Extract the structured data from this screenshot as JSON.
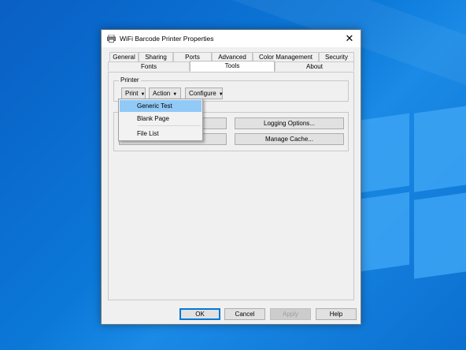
{
  "dialog": {
    "title": "WiFi Barcode Printer Properties",
    "close_glyph": "✕"
  },
  "tabs": {
    "row1": [
      "General",
      "Sharing",
      "Ports",
      "Advanced",
      "Color Management",
      "Security"
    ],
    "row2": [
      "Fonts",
      "Tools",
      "About"
    ],
    "active": "Tools"
  },
  "printer_group": {
    "label": "Printer",
    "print_label": "Print",
    "action_label": "Action",
    "configure_label": "Configure",
    "arrow_glyph": "▼"
  },
  "tools_group": {
    "logging_label": "Logging Options...",
    "cache_label": "Manage Cache..."
  },
  "print_menu": {
    "items": [
      "Generic Test",
      "Blank Page",
      "File List"
    ],
    "highlighted": "Generic Test"
  },
  "footer": {
    "ok": "OK",
    "cancel": "Cancel",
    "apply": "Apply",
    "help": "Help"
  }
}
